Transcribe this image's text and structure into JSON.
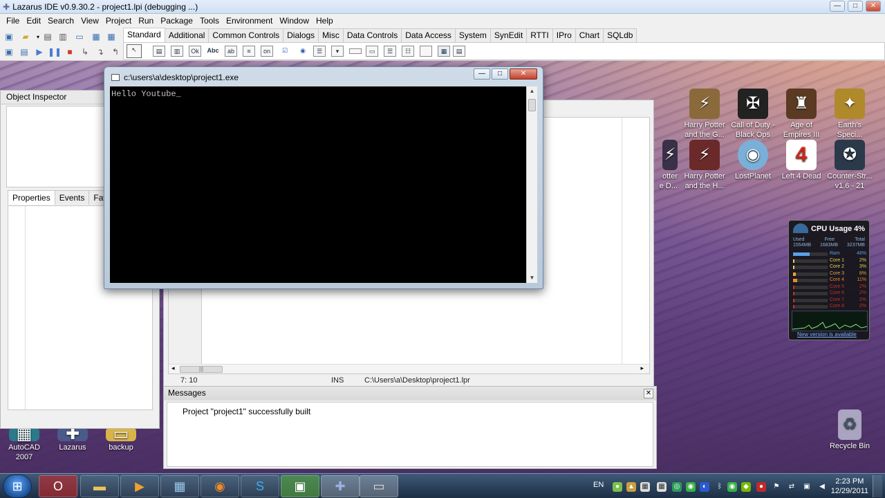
{
  "ide": {
    "title": "Lazarus IDE v0.9.30.2 - project1.lpi (debugging ...)",
    "menu": [
      "File",
      "Edit",
      "Search",
      "View",
      "Project",
      "Run",
      "Package",
      "Tools",
      "Environment",
      "Window",
      "Help"
    ],
    "palette_tabs": [
      "Standard",
      "Additional",
      "Common Controls",
      "Dialogs",
      "Misc",
      "Data Controls",
      "Data Access",
      "System",
      "SynEdit",
      "RTTI",
      "IPro",
      "Chart",
      "SQLdb"
    ],
    "palette_active": "Standard",
    "palette_icons": [
      "pointer",
      "frame",
      "main-menu",
      "popup-menu",
      "button",
      "label",
      "edit",
      "memo",
      "toggle",
      "checkbox",
      "radio",
      "listbox",
      "combobox",
      "scrollbar",
      "groupbox",
      "radiogroup",
      "checkgroup",
      "panel",
      "actionlist"
    ]
  },
  "object_inspector": {
    "title": "Object Inspector",
    "tabs": [
      "Properties",
      "Events",
      "Favor"
    ],
    "active_tab": "Properties"
  },
  "editor": {
    "status": {
      "position": "7: 10",
      "mode": "INS",
      "file": "C:\\Users\\a\\Desktop\\project1.lpr"
    }
  },
  "messages": {
    "title": "Messages",
    "lines": [
      "Project \"project1\" successfully built"
    ]
  },
  "console": {
    "title": "c:\\users\\a\\desktop\\project1.exe",
    "output": "Hello Youtube_"
  },
  "desktop_icons": [
    {
      "label1": "Harry Potter",
      "label2": "and the G...",
      "icon": "harry-potter-icon"
    },
    {
      "label1": "Call of Duty -",
      "label2": "Black Ops",
      "icon": "cod-icon"
    },
    {
      "label1": "Age of",
      "label2": "Empires III",
      "icon": "aoe-icon"
    },
    {
      "label1": "Earth's",
      "label2": "Speci...",
      "icon": "earth-icon"
    },
    {
      "label1": "otter",
      "label2": "e D...",
      "icon": "hp2-icon"
    },
    {
      "label1": "Harry Potter",
      "label2": "and the H...",
      "icon": "hp3-icon"
    },
    {
      "label1": "LostPlanet",
      "label2": "",
      "icon": "lostplanet-icon"
    },
    {
      "label1": "Left 4 Dead",
      "label2": "",
      "icon": "l4d-icon"
    },
    {
      "label1": "Counter-Str...",
      "label2": "v1.6 - 21",
      "icon": "cs-icon"
    },
    {
      "label1": "AutoCAD",
      "label2": "2007",
      "icon": "autocad-icon"
    },
    {
      "label1": "Lazarus",
      "label2": "",
      "icon": "lazarus-icon"
    },
    {
      "label1": "backup",
      "label2": "",
      "icon": "folder-icon"
    },
    {
      "label1": "Recycle Bin",
      "label2": "",
      "icon": "recycle-bin-icon"
    }
  ],
  "cpu_gadget": {
    "title": "CPU Usage",
    "percent": "4%",
    "mem_headers": [
      "Used",
      "Free",
      "Total"
    ],
    "mem_values": [
      "1554MB",
      "1683MB",
      "3237MB"
    ],
    "rows": [
      {
        "label": "Ram",
        "value": "48%",
        "fill": 0.48,
        "color": "#5aa0e6"
      },
      {
        "label": "Core 1",
        "value": "2%",
        "fill": 0.02,
        "color": "#e6d34a"
      },
      {
        "label": "Core 2",
        "value": "3%",
        "fill": 0.03,
        "color": "#e6d34a"
      },
      {
        "label": "Core 3",
        "value": "8%",
        "fill": 0.08,
        "color": "#e6a53a"
      },
      {
        "label": "Core 4",
        "value": "11%",
        "fill": 0.11,
        "color": "#e68a2a"
      },
      {
        "label": "Core 5",
        "value": "2%",
        "fill": 0.02,
        "color": "#c0342a"
      },
      {
        "label": "Core 6",
        "value": "2%",
        "fill": 0.02,
        "color": "#c0342a"
      },
      {
        "label": "Core 7",
        "value": "2%",
        "fill": 0.02,
        "color": "#c0342a"
      },
      {
        "label": "Core 8",
        "value": "2%",
        "fill": 0.02,
        "color": "#c0342a"
      }
    ],
    "link": "New version is available"
  },
  "taskbar": {
    "lang": "EN",
    "time": "2:23 PM",
    "date": "12/29/2011"
  }
}
